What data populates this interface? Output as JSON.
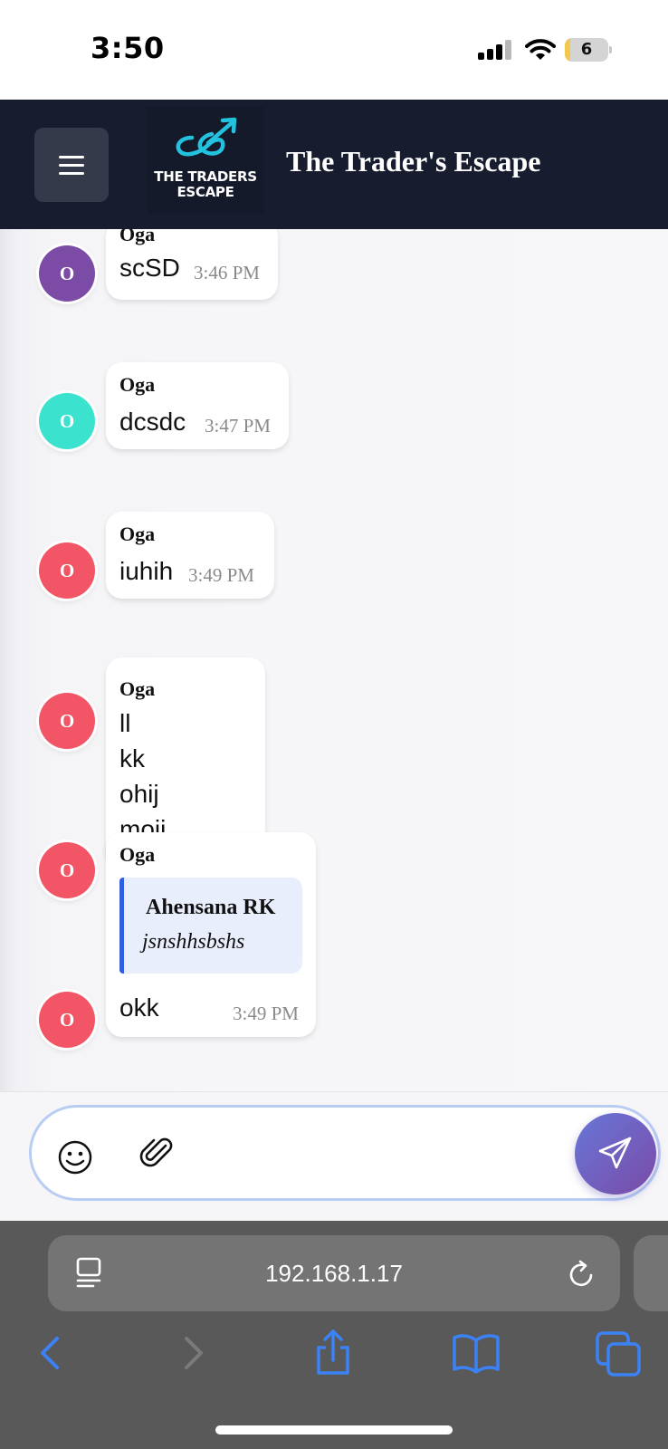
{
  "status_bar": {
    "time": "3:50",
    "battery_level": "6",
    "battery_fraction": 0.06
  },
  "header": {
    "logo_line1": "THE TRADERS",
    "logo_line2": "ESCAPE",
    "title": "The Trader's Escape"
  },
  "messages": [
    {
      "sender": "Oga",
      "avatar_letter": "O",
      "avatar_color": "#7b4ba6",
      "text": "scSD",
      "time": "3:46 PM"
    },
    {
      "sender": "Oga",
      "avatar_letter": "O",
      "avatar_color": "#3be3cf",
      "text": "dcsdc",
      "time": "3:47 PM"
    },
    {
      "sender": "Oga",
      "avatar_letter": "O",
      "avatar_color": "#f25566",
      "text": "iuhih",
      "time": "3:49 PM"
    },
    {
      "sender": "Oga",
      "avatar_letter": "O",
      "avatar_color": "#f25566",
      "lines": [
        "ll",
        "kk",
        "ohij",
        "moij"
      ]
    },
    {
      "sender": "Oga",
      "avatar_letter": "O",
      "avatar_color": "#f25566"
    },
    {
      "sender": "Oga",
      "avatar_letter": "O",
      "avatar_color": "#f25566",
      "reply_author": "Ahensana RK",
      "reply_text": "jsnshhsbshs",
      "text": "okk",
      "time": "3:49 PM"
    }
  ],
  "composer": {
    "placeholder": "",
    "accent": "#6a5acd"
  },
  "browser": {
    "url": "192.168.1.17"
  },
  "icons": {
    "menu": "hamburger-icon",
    "emoji": "smiley-icon",
    "attach": "paperclip-icon",
    "send": "paper-plane-icon",
    "page": "page-format-icon",
    "reload": "reload-icon",
    "back": "chevron-left-icon",
    "forward": "chevron-right-icon",
    "share": "share-icon",
    "bookmarks": "book-icon",
    "tabs": "tabs-icon"
  }
}
